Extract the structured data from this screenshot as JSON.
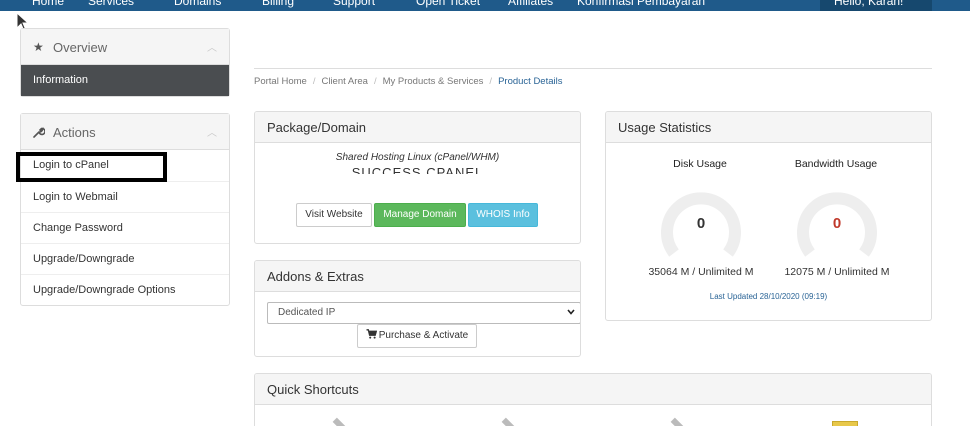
{
  "nav": {
    "items": [
      "Home",
      "Services",
      "Domains",
      "Billing",
      "Support",
      "Open Ticket",
      "Affiliates",
      "Konfirmasi Pembayaran"
    ],
    "user": "Hello, Karan!"
  },
  "sidebar": {
    "overview": {
      "title": "Overview",
      "active_item": "Information"
    },
    "actions": {
      "title": "Actions",
      "items": [
        "Login to cPanel",
        "Login to Webmail",
        "Change Password",
        "Upgrade/Downgrade",
        "Upgrade/Downgrade Options"
      ]
    }
  },
  "breadcrumb": [
    "Portal Home",
    "Client Area",
    "My Products & Services",
    "Product Details"
  ],
  "package": {
    "title": "Package/Domain",
    "product": "Shared Hosting Linux (cPanel/WHM)",
    "status": "SUCCESS CPANEL",
    "buttons": {
      "visit": "Visit Website",
      "manage": "Manage Domain",
      "whois": "WHOIS Info"
    }
  },
  "addons": {
    "title": "Addons & Extras",
    "selected": "Dedicated IP",
    "purchase": "Purchase & Activate"
  },
  "usage": {
    "title": "Usage Statistics",
    "disk": {
      "label": "Disk Usage",
      "value": "0",
      "caption": "35064 M / Unlimited M"
    },
    "bandwidth": {
      "label": "Bandwidth Usage",
      "value": "0",
      "caption": "12075 M / Unlimited M"
    },
    "last_updated": "Last Updated 28/10/2020 (09:19)",
    "colors": {
      "disk_value": "#333333",
      "bandwidth_value": "#c0392b",
      "gauge_track": "#eeeeee"
    }
  },
  "shortcuts": {
    "title": "Quick Shortcuts"
  },
  "colors": {
    "nav_bg": "#1f5a8a",
    "sidebar_active": "#4a4d50",
    "link": "#2a6496"
  }
}
